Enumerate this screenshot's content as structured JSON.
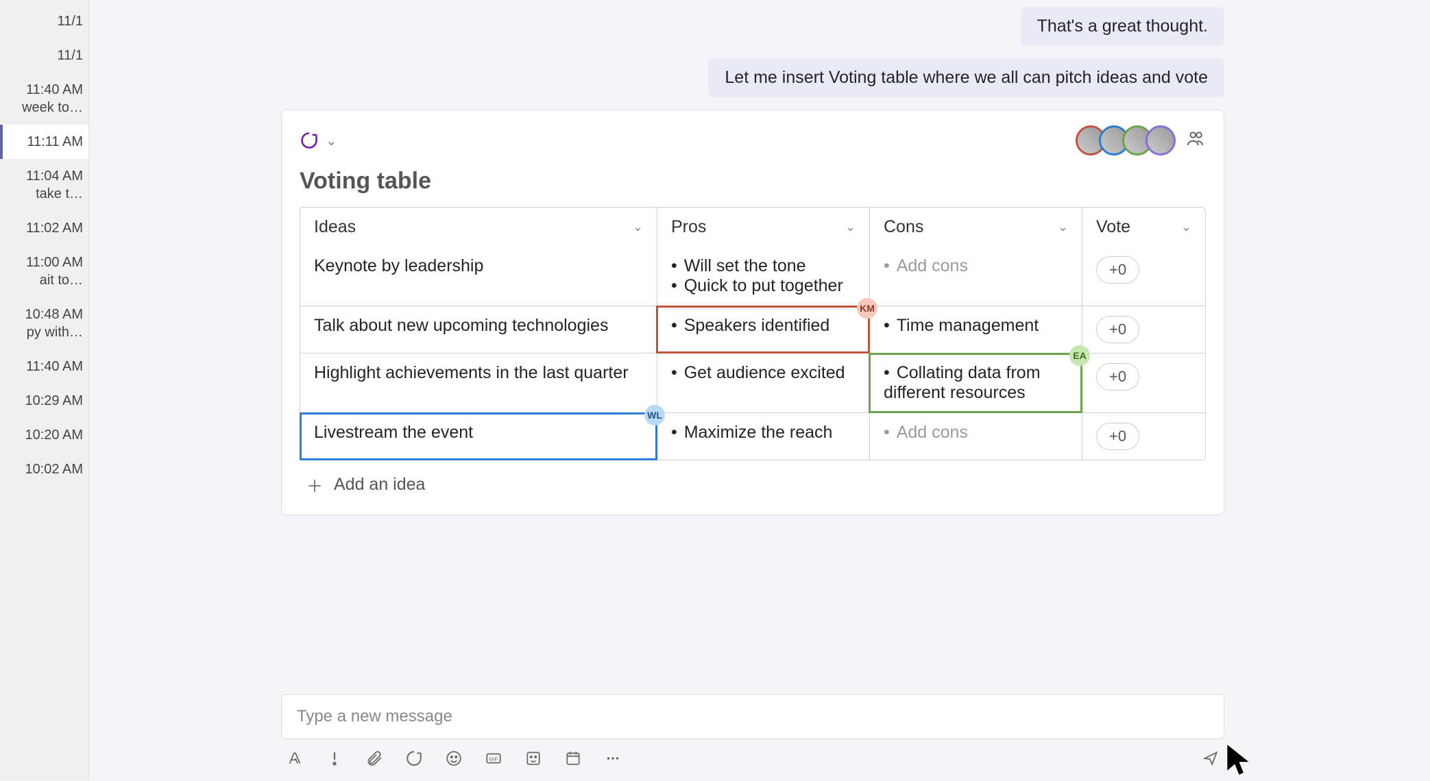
{
  "sidebar": {
    "items": [
      {
        "time": "11/1",
        "sub": ""
      },
      {
        "time": "11/1",
        "sub": ""
      },
      {
        "time": "11:40 AM",
        "sub": " week to…"
      },
      {
        "time": "11:11 AM",
        "sub": ""
      },
      {
        "time": "11:04 AM",
        "sub": " take t…"
      },
      {
        "time": "11:02 AM",
        "sub": ""
      },
      {
        "time": "11:00 AM",
        "sub": "ait to…"
      },
      {
        "time": "10:48 AM",
        "sub": "py with…"
      },
      {
        "time": "11:40 AM",
        "sub": ""
      },
      {
        "time": "10:29 AM",
        "sub": ""
      },
      {
        "time": "10:20 AM",
        "sub": ""
      },
      {
        "time": "10:02 AM",
        "sub": ""
      }
    ],
    "selectedIndex": 3
  },
  "messages": {
    "m1": "That's a great thought.",
    "m2": "Let me insert Voting table where we all can pitch ideas and vote"
  },
  "card": {
    "title": "Voting table",
    "columns": {
      "ideas": "Ideas",
      "pros": "Pros",
      "cons": "Cons",
      "vote": "Vote"
    },
    "rows": [
      {
        "idea": "Keynote by leadership",
        "pros": [
          "Will set the tone",
          "Quick to put together"
        ],
        "cons_placeholder": "Add cons",
        "vote": "+0"
      },
      {
        "idea": "Talk about new upcoming technologies",
        "pros": [
          "Speakers identified"
        ],
        "cons": [
          "Time management"
        ],
        "vote": "+0",
        "sel_pros": "red",
        "badge_pros": "KM"
      },
      {
        "idea": "Highlight achievements in the last quarter",
        "pros": [
          "Get audience excited"
        ],
        "cons": [
          "Collating data from different resources"
        ],
        "vote": "+0",
        "sel_cons": "green",
        "badge_cons": "EA"
      },
      {
        "idea": "Livestream the event",
        "pros": [
          "Maximize the reach"
        ],
        "cons_placeholder": "Add cons",
        "vote": "+0",
        "sel_idea": "blue",
        "badge_idea": "WL"
      }
    ],
    "add_idea": "Add an idea",
    "avatars": [
      {
        "ring": "#c0533e"
      },
      {
        "ring": "#2b7cd3"
      },
      {
        "ring": "#6ba54a"
      },
      {
        "ring": "#8b6dd6"
      }
    ]
  },
  "compose": {
    "placeholder": "Type a new message"
  }
}
